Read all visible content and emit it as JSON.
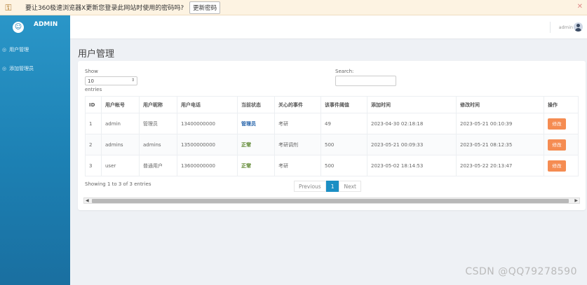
{
  "notice": {
    "message": "要让360极速浏览器X更新您登录此网站时使用的密码吗?",
    "button": "更新密码",
    "close": "✕"
  },
  "sidebar": {
    "brand": "ADMIN",
    "items": [
      {
        "label": "用户管理"
      },
      {
        "label": "添加管理员"
      }
    ]
  },
  "header": {
    "username": "admin"
  },
  "page": {
    "title": "用户管理"
  },
  "table_controls": {
    "show_label": "Show",
    "show_value": "10",
    "entries_label": "entries",
    "search_label": "Search:"
  },
  "table": {
    "columns": [
      "ID",
      "用户帐号",
      "用户昵称",
      "用户电话",
      "当前状态",
      "关心的事件",
      "该事件阈值",
      "添加时间",
      "修改时间",
      "操作"
    ],
    "rows": [
      {
        "id": "1",
        "account": "admin",
        "nickname": "管理员",
        "phone": "13400000000",
        "status": "管理员",
        "event": "考研",
        "threshold": "49",
        "created": "2023-04-30 02:18:18",
        "modified": "2023-05-21 00:10:39",
        "action": "修改"
      },
      {
        "id": "2",
        "account": "admins",
        "nickname": "admins",
        "phone": "13500000000",
        "status": "正常",
        "event": "考研调剂",
        "threshold": "500",
        "created": "2023-05-21 00:09:33",
        "modified": "2023-05-21 08:12:35",
        "action": "修改"
      },
      {
        "id": "3",
        "account": "user",
        "nickname": "普通用户",
        "phone": "13600000000",
        "status": "正常",
        "event": "考研",
        "threshold": "500",
        "created": "2023-05-02 18:14:53",
        "modified": "2023-05-22 20:13:47",
        "action": "修改"
      }
    ]
  },
  "footer": {
    "info": "Showing 1 to 3 of 3 entries",
    "previous": "Previous",
    "current_page": "1",
    "next": "Next"
  },
  "watermark": "CSDN @QQ79278590",
  "colors": {
    "sidebar": "#1c80b3",
    "accent": "#1c8fc4",
    "edit_button": "#f58c52",
    "status_admin": "#1f5fa8",
    "status_normal": "#4c7a1a"
  }
}
